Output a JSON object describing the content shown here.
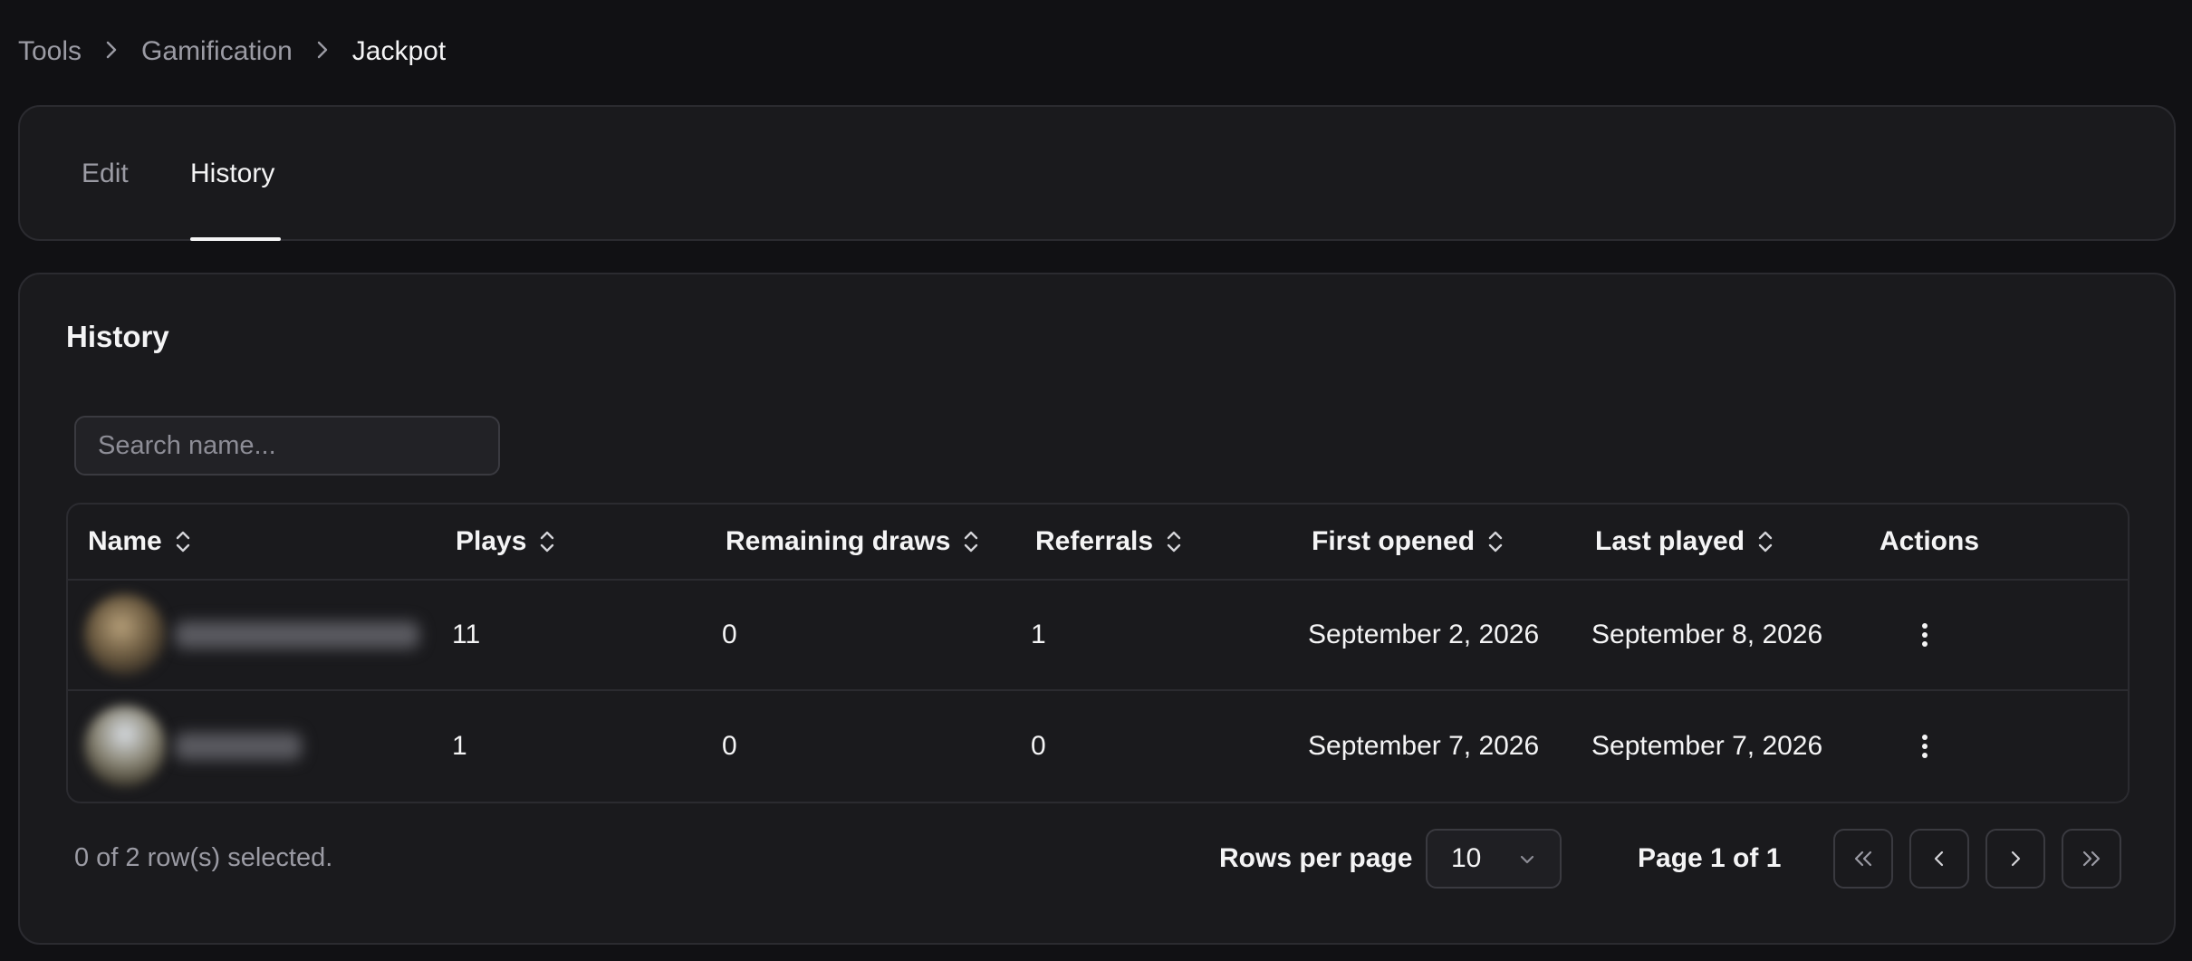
{
  "breadcrumb": {
    "items": [
      "Tools",
      "Gamification",
      "Jackpot"
    ]
  },
  "tabs": {
    "edit": "Edit",
    "history": "History"
  },
  "section": {
    "title": "History"
  },
  "search": {
    "placeholder": "Search name..."
  },
  "table": {
    "columns": [
      "Name",
      "Plays",
      "Remaining draws",
      "Referrals",
      "First opened",
      "Last played",
      "Actions"
    ],
    "rows": [
      {
        "plays": "11",
        "remaining": "0",
        "referrals": "1",
        "first_opened": "September 2, 2026",
        "last_played": "September 8, 2026"
      },
      {
        "plays": "1",
        "remaining": "0",
        "referrals": "0",
        "first_opened": "September 7, 2026",
        "last_played": "September 7, 2026"
      }
    ]
  },
  "footer": {
    "selection": "0 of 2 row(s) selected.",
    "rows_per_page_label": "Rows per page",
    "rows_per_page_value": "10",
    "page_info": "Page 1 of 1"
  },
  "colors": {
    "background": "#111114",
    "card": "#1a1a1d",
    "border": "#2b2b30",
    "text": "#f4f4f5",
    "muted": "#9b9ba4"
  },
  "icons": [
    "chevron-right-icon",
    "sort-icon",
    "more-vertical-icon",
    "chevron-down-icon",
    "chevrons-left-icon",
    "chevron-left-icon",
    "chevron-right-icon",
    "chevrons-right-icon"
  ]
}
